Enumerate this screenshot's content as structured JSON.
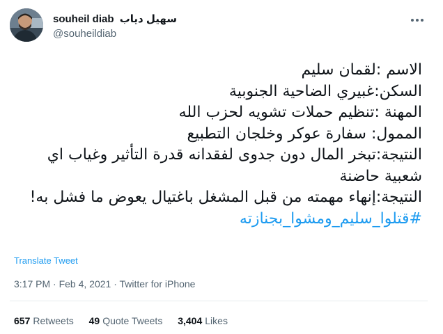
{
  "author": {
    "display_name": "souheil diab",
    "display_name_ar": "سهيل دياب",
    "username": "@souheildiab",
    "avatar_icon": "avatar-photo"
  },
  "tweet": {
    "lines": [
      "الاسم :لقمان سليم",
      "السكن:غبيري الضاحية الجنوبية",
      "المهنة :تنظيم حملات تشويه لحزب الله",
      "الممول: سفارة عوكر وخلجان التطبيع",
      "النتيجة:تبخر المال دون جدوى لفقدانه قدرة التأثير وغياب اي شعبية حاضنة",
      "النتيجة:إنهاء مهمته من قبل المشغل باغتيال يعوض ما فشل به!"
    ],
    "hashtag": "#قتلوا_سليم_ومشوا_بجنازته"
  },
  "translate_label": "Translate Tweet",
  "meta": {
    "time": "3:17 PM",
    "separator": "·",
    "date": "Feb 4, 2021",
    "source": "Twitter for iPhone"
  },
  "stats": {
    "retweets_count": "657",
    "retweets_label": "Retweets",
    "quotes_count": "49",
    "quotes_label": "Quote Tweets",
    "likes_count": "3,404",
    "likes_label": "Likes"
  },
  "colors": {
    "link": "#1d9bf0",
    "text": "#0f1419",
    "secondary": "#536471"
  }
}
